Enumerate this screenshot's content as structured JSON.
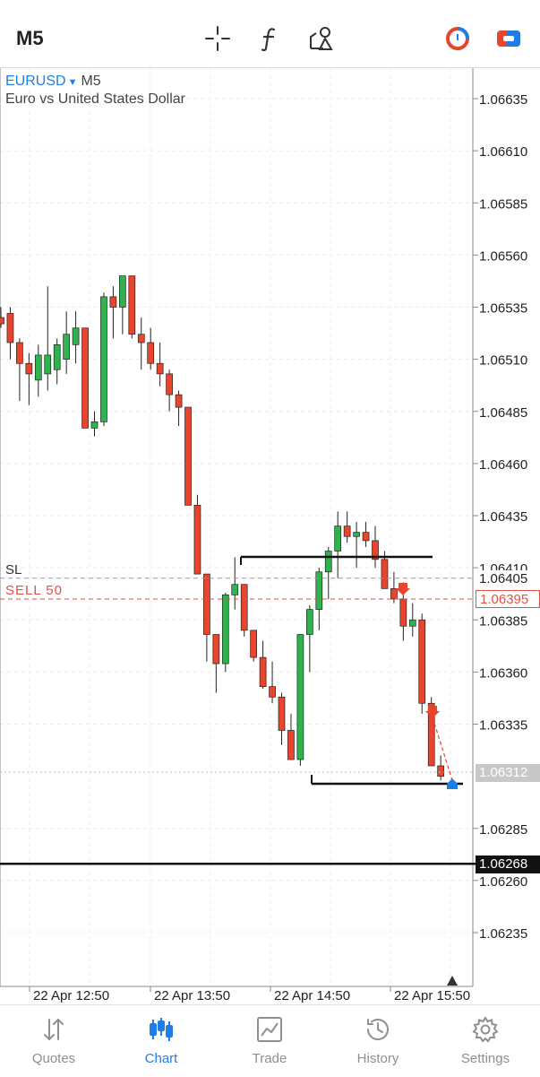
{
  "toolbar": {
    "timeframe": "M5",
    "icons": [
      "crosshair-icon",
      "function-icon",
      "objects-icon",
      "one-click-trading-icon",
      "trade-panel-icon"
    ]
  },
  "symbol": {
    "name": "EURUSD",
    "timeframe": "M5",
    "description": "Euro vs United States Dollar"
  },
  "price_axis": [
    "1.06635",
    "1.06610",
    "1.06585",
    "1.06560",
    "1.06535",
    "1.06510",
    "1.06485",
    "1.06460",
    "1.06435",
    "1.06410",
    "1.06385",
    "1.06360",
    "1.06335",
    "1.06285",
    "1.06260",
    "1.06235"
  ],
  "time_axis": [
    "22 Apr 12:50",
    "22 Apr 13:50",
    "22 Apr 14:50",
    "22 Apr 15:50"
  ],
  "levels": {
    "sl": {
      "label": "SL",
      "price": "1.06405"
    },
    "sell": {
      "label": "SELL 50",
      "price": "1.06395"
    },
    "bid": {
      "price": "1.06312"
    },
    "line": {
      "price": "1.06268"
    }
  },
  "colors": {
    "bull": "#2fb34e",
    "bear": "#e8452c",
    "accent": "#1e7ee6",
    "sell": "#e25045"
  },
  "candles": [
    [
      1.0653,
      1.06535,
      1.06525,
      1.06527
    ],
    [
      1.06532,
      1.06535,
      1.0651,
      1.06518
    ],
    [
      1.06518,
      1.0652,
      1.0649,
      1.06508
    ],
    [
      1.06508,
      1.06513,
      1.06488,
      1.06503
    ],
    [
      1.065,
      1.06517,
      1.06492,
      1.06512
    ],
    [
      1.06503,
      1.06545,
      1.06495,
      1.06512
    ],
    [
      1.06505,
      1.0652,
      1.06498,
      1.06517
    ],
    [
      1.0651,
      1.06533,
      1.06503,
      1.06522
    ],
    [
      1.06517,
      1.06533,
      1.06508,
      1.06525
    ],
    [
      1.06525,
      1.0652,
      1.06478,
      1.06477
    ],
    [
      1.06477,
      1.06485,
      1.06473,
      1.0648
    ],
    [
      1.0648,
      1.06542,
      1.06478,
      1.0654
    ],
    [
      1.0654,
      1.06545,
      1.0652,
      1.06535
    ],
    [
      1.06535,
      1.0655,
      1.06522,
      1.0655
    ],
    [
      1.0655,
      1.0655,
      1.0652,
      1.06522
    ],
    [
      1.06522,
      1.0653,
      1.06505,
      1.06518
    ],
    [
      1.06518,
      1.06525,
      1.06505,
      1.06508
    ],
    [
      1.06508,
      1.06518,
      1.06497,
      1.06503
    ],
    [
      1.06503,
      1.06505,
      1.06485,
      1.06493
    ],
    [
      1.06493,
      1.06495,
      1.06478,
      1.06487
    ],
    [
      1.06487,
      1.06487,
      1.0644,
      1.0644
    ],
    [
      1.0644,
      1.06445,
      1.06415,
      1.06407
    ],
    [
      1.06407,
      1.06407,
      1.06365,
      1.06378
    ],
    [
      1.06378,
      1.06378,
      1.0635,
      1.06364
    ],
    [
      1.06364,
      1.06398,
      1.0636,
      1.06397
    ],
    [
      1.06397,
      1.06415,
      1.0639,
      1.06402
    ],
    [
      1.06402,
      1.06402,
      1.06377,
      1.0638
    ],
    [
      1.0638,
      1.0638,
      1.06365,
      1.06367
    ],
    [
      1.06367,
      1.06375,
      1.06352,
      1.06353
    ],
    [
      1.06353,
      1.06365,
      1.06345,
      1.06348
    ],
    [
      1.06348,
      1.0635,
      1.06325,
      1.06332
    ],
    [
      1.06332,
      1.0634,
      1.06318,
      1.06318
    ],
    [
      1.06318,
      1.06378,
      1.06315,
      1.06378
    ],
    [
      1.06378,
      1.06392,
      1.0636,
      1.0639
    ],
    [
      1.0639,
      1.0641,
      1.0638,
      1.06408
    ],
    [
      1.06408,
      1.0642,
      1.06395,
      1.06418
    ],
    [
      1.06418,
      1.06437,
      1.06405,
      1.0643
    ],
    [
      1.0643,
      1.06437,
      1.06422,
      1.06425
    ],
    [
      1.06425,
      1.06432,
      1.0641,
      1.06427
    ],
    [
      1.06427,
      1.06432,
      1.0642,
      1.06423
    ],
    [
      1.06423,
      1.0643,
      1.0641,
      1.06414
    ],
    [
      1.06414,
      1.06418,
      1.064,
      1.064
    ],
    [
      1.064,
      1.06408,
      1.06393,
      1.06395
    ],
    [
      1.06395,
      1.06403,
      1.06375,
      1.06382
    ],
    [
      1.06382,
      1.06393,
      1.06377,
      1.06385
    ],
    [
      1.06385,
      1.06388,
      1.0634,
      1.06345
    ],
    [
      1.06345,
      1.06348,
      1.06315,
      1.06315
    ],
    [
      1.06315,
      1.0632,
      1.06308,
      1.0631
    ]
  ]
}
